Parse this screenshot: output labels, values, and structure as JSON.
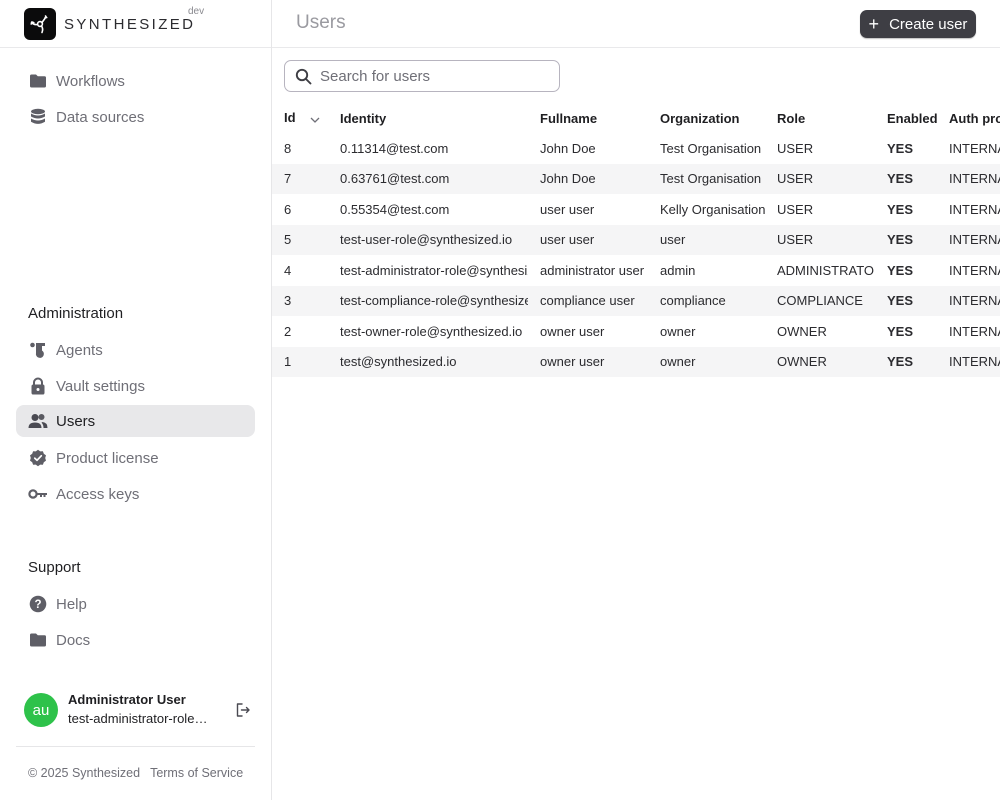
{
  "brand": {
    "name": "SYNTHESIZED",
    "env": "dev"
  },
  "sidebar": {
    "main_items": [
      {
        "label": "Workflows",
        "icon": "folder-icon"
      },
      {
        "label": "Data sources",
        "icon": "database-icon"
      }
    ],
    "administration": {
      "title": "Administration",
      "items": [
        {
          "label": "Agents",
          "icon": "agents-icon"
        },
        {
          "label": "Vault settings",
          "icon": "lock-icon"
        },
        {
          "label": "Users",
          "icon": "users-icon",
          "active": true
        },
        {
          "label": "Product license",
          "icon": "verified-badge-icon"
        },
        {
          "label": "Access keys",
          "icon": "key-icon"
        }
      ]
    },
    "support": {
      "title": "Support",
      "items": [
        {
          "label": "Help",
          "icon": "help-icon"
        },
        {
          "label": "Docs",
          "icon": "folder-icon"
        }
      ]
    },
    "user": {
      "initials": "au",
      "name": "Administrator User",
      "email": "test-administrator-role@synthesized.io",
      "avatar_color": "#2ec24a"
    },
    "footer": {
      "copyright": "© 2025 Synthesized",
      "terms": "Terms of Service"
    }
  },
  "header": {
    "title": "Users",
    "create_button": "Create user"
  },
  "search": {
    "placeholder": "Search for users",
    "value": ""
  },
  "table": {
    "columns": [
      "Id",
      "Identity",
      "Fullname",
      "Organization",
      "Role",
      "Enabled",
      "Auth provider"
    ],
    "sort": {
      "column": "Id",
      "direction": "desc"
    },
    "rows": [
      {
        "id": "8",
        "identity": "0.11314@test.com",
        "fullname": "John Doe",
        "organization": "Test Organisation",
        "role": "USER",
        "enabled": "YES",
        "auth": "INTERNAL"
      },
      {
        "id": "7",
        "identity": "0.63761@test.com",
        "fullname": "John Doe",
        "organization": "Test Organisation",
        "role": "USER",
        "enabled": "YES",
        "auth": "INTERNAL"
      },
      {
        "id": "6",
        "identity": "0.55354@test.com",
        "fullname": "user user",
        "organization": "Kelly Organisation",
        "role": "USER",
        "enabled": "YES",
        "auth": "INTERNAL"
      },
      {
        "id": "5",
        "identity": "test-user-role@synthesized.io",
        "fullname": "user user",
        "organization": "user",
        "role": "USER",
        "enabled": "YES",
        "auth": "INTERNAL"
      },
      {
        "id": "4",
        "identity": "test-administrator-role@synthesized.io",
        "fullname": "administrator user",
        "organization": "admin",
        "role": "ADMINISTRATOR",
        "enabled": "YES",
        "auth": "INTERNAL"
      },
      {
        "id": "3",
        "identity": "test-compliance-role@synthesized.io",
        "fullname": "compliance user",
        "organization": "compliance",
        "role": "COMPLIANCE",
        "enabled": "YES",
        "auth": "INTERNAL"
      },
      {
        "id": "2",
        "identity": "test-owner-role@synthesized.io",
        "fullname": "owner user",
        "organization": "owner",
        "role": "OWNER",
        "enabled": "YES",
        "auth": "INTERNAL"
      },
      {
        "id": "1",
        "identity": "test@synthesized.io",
        "fullname": "owner user",
        "organization": "owner",
        "role": "OWNER",
        "enabled": "YES",
        "auth": "INTERNAL"
      }
    ]
  }
}
